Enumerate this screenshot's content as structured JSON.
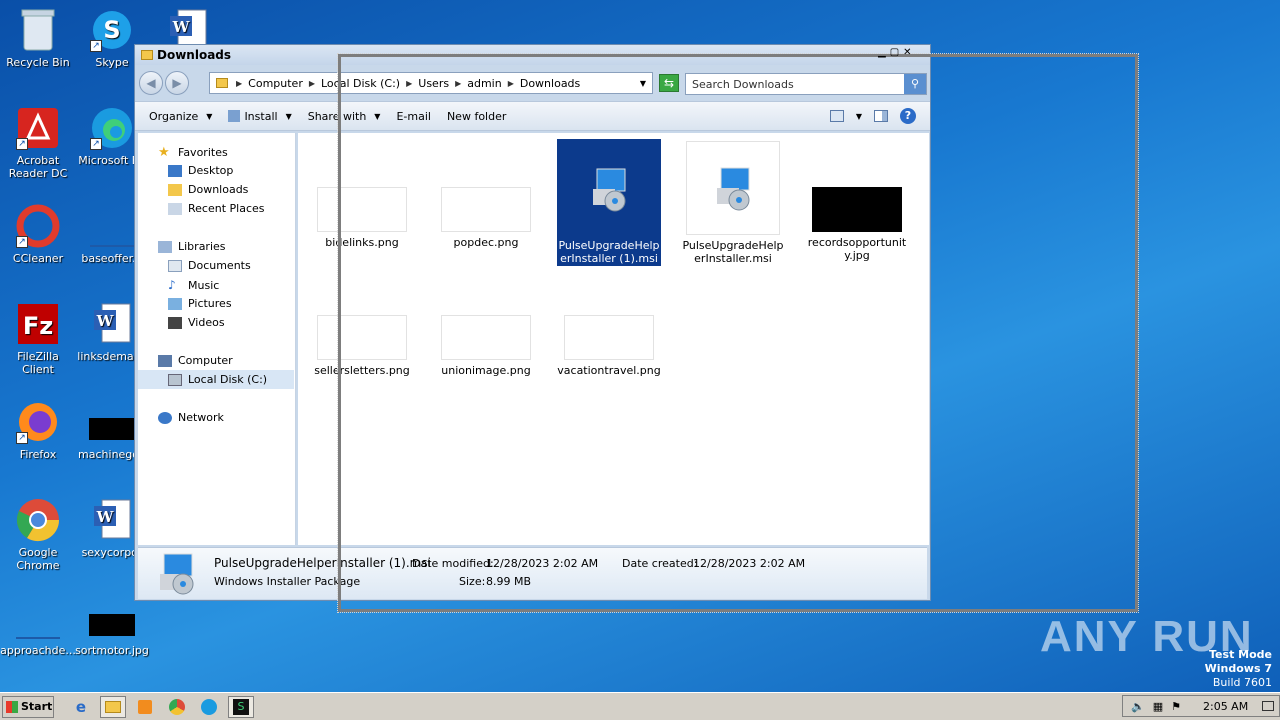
{
  "desktop": {
    "icons": [
      {
        "label": "Recycle Bin",
        "icon": "recycle-bin-icon"
      },
      {
        "label": "Skype",
        "icon": "skype-icon"
      },
      {
        "label": "Acrobat Reader DC",
        "icon": "acrobat-icon"
      },
      {
        "label": "Microsoft Ed",
        "icon": "edge-icon"
      },
      {
        "label": "CCleaner",
        "icon": "ccleaner-icon"
      },
      {
        "label": "baseoffer.p",
        "icon": "word-doc-icon"
      },
      {
        "label": "FileZilla Client",
        "icon": "filezilla-icon"
      },
      {
        "label": "linksdemanc",
        "icon": "word-doc-icon"
      },
      {
        "label": "Firefox",
        "icon": "firefox-icon"
      },
      {
        "label": "machinegolf",
        "icon": "image-icon"
      },
      {
        "label": "Google Chrome",
        "icon": "chrome-icon"
      },
      {
        "label": "sexycorpor",
        "icon": "word-doc-icon"
      },
      {
        "label": "approachde...",
        "icon": "image-icon"
      },
      {
        "label": "sortmotor.jpg",
        "icon": "image-icon"
      }
    ]
  },
  "window": {
    "title": "Downloads",
    "address": {
      "crumbs": [
        "Computer",
        "Local Disk (C:)",
        "Users",
        "admin",
        "Downloads"
      ]
    },
    "search_placeholder": "Search Downloads",
    "toolbar": {
      "organize": "Organize",
      "install": "Install",
      "share_with": "Share with",
      "email": "E-mail",
      "new_folder": "New folder"
    },
    "nav": {
      "favorites": "Favorites",
      "desktop": "Desktop",
      "downloads": "Downloads",
      "recent_places": "Recent Places",
      "libraries": "Libraries",
      "documents": "Documents",
      "music": "Music",
      "pictures": "Pictures",
      "videos": "Videos",
      "computer": "Computer",
      "local_disk": "Local Disk (C:)",
      "network": "Network"
    },
    "files": [
      {
        "name": "bidelinks.png",
        "type": "png"
      },
      {
        "name": "popdec.png",
        "type": "png"
      },
      {
        "name": "PulseUpgradeHelperInstaller (1).msi",
        "type": "msi",
        "selected": true
      },
      {
        "name": "PulseUpgradeHelperInstaller.msi",
        "type": "msi"
      },
      {
        "name": "recordsopportunity.jpg",
        "type": "jpg"
      },
      {
        "name": "sellersletters.png",
        "type": "png"
      },
      {
        "name": "unionimage.png",
        "type": "png"
      },
      {
        "name": "vacationtravel.png",
        "type": "png"
      }
    ],
    "details": {
      "filename": "PulseUpgradeHelperInstaller (1).msi",
      "type": "Windows Installer Package",
      "modified_label": "Date modified:",
      "modified": "12/28/2023 2:02 AM",
      "created_label": "Date created:",
      "created": "12/28/2023 2:02 AM",
      "size_label": "Size:",
      "size": "8.99 MB"
    }
  },
  "taskbar": {
    "start": "Start",
    "clock": "2:05 AM"
  },
  "watermark": {
    "line1": "Test Mode",
    "line2": "Windows 7",
    "line3": "Build 7601",
    "brand": "ANY RUN"
  }
}
